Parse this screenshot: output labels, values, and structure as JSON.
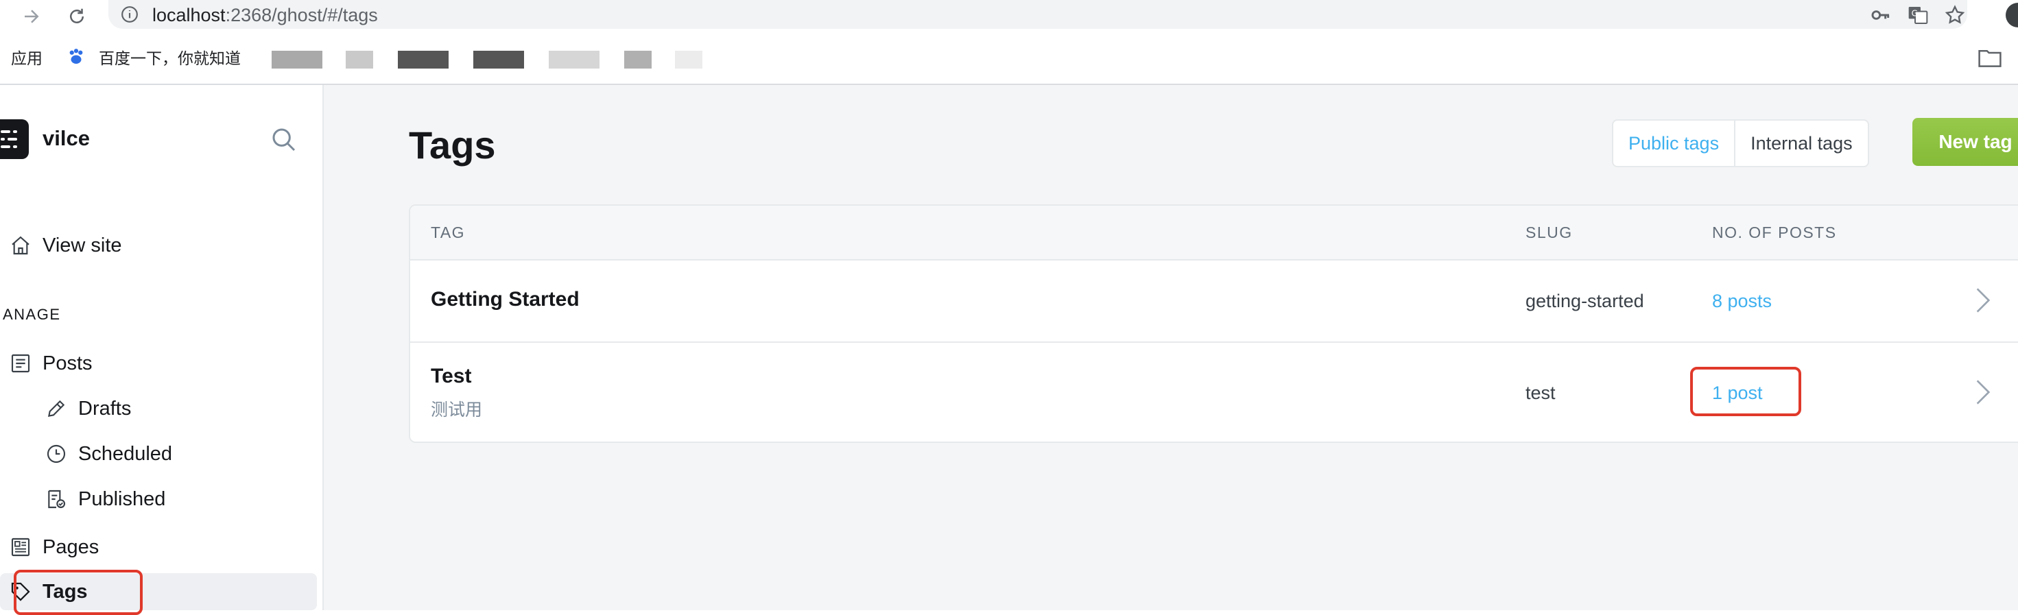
{
  "browser": {
    "url_host": "localhost",
    "url_path": ":2368/ghost/#/tags",
    "bookmarks": {
      "apps_label": "应用",
      "baidu_label": "百度一下，你就知道"
    },
    "icons": [
      "forward-arrow-icon",
      "reload-icon",
      "info-icon",
      "key-icon",
      "translate-icon",
      "star-icon",
      "folder-icon"
    ]
  },
  "sidebar": {
    "site_name": "vilce",
    "view_site": "View site",
    "section_title": "ANAGE",
    "items": [
      {
        "label": "Posts"
      },
      {
        "label": "Drafts"
      },
      {
        "label": "Scheduled"
      },
      {
        "label": "Published"
      },
      {
        "label": "Pages"
      },
      {
        "label": "Tags"
      }
    ]
  },
  "main": {
    "title": "Tags",
    "tabs": {
      "public": "Public tags",
      "internal": "Internal tags"
    },
    "new_tag": "New tag",
    "table": {
      "headers": {
        "tag": "TAG",
        "slug": "SLUG",
        "posts": "NO. OF POSTS"
      },
      "rows": [
        {
          "name": "Getting Started",
          "description": "",
          "slug": "getting-started",
          "posts": "8 posts"
        },
        {
          "name": "Test",
          "description": "测试用",
          "slug": "test",
          "posts": "1 post"
        }
      ]
    }
  },
  "colors": {
    "accent_blue": "#3eb0ef",
    "new_tag_green": "#84bb37",
    "annotation_red": "#e0392b"
  }
}
